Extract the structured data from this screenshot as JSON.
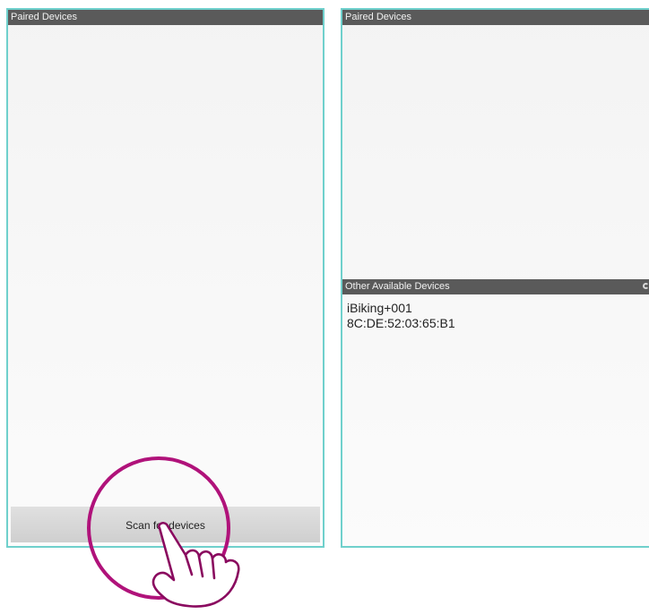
{
  "left_screen": {
    "paired_header": "Paired Devices",
    "scan_button_label": "Scan for devices"
  },
  "right_screen": {
    "paired_header": "Paired Devices",
    "other_header": "Other Available Devices",
    "devices": [
      {
        "name": "iBiking+001",
        "address": "8C:DE:52:03:65:B1"
      }
    ]
  },
  "colors": {
    "header_bg": "#5a5a5a",
    "frame_border": "#6fd0cc",
    "highlight_circle": "#b0127a"
  },
  "icons": [
    "tap-hand-icon",
    "loading-spinner-icon"
  ]
}
